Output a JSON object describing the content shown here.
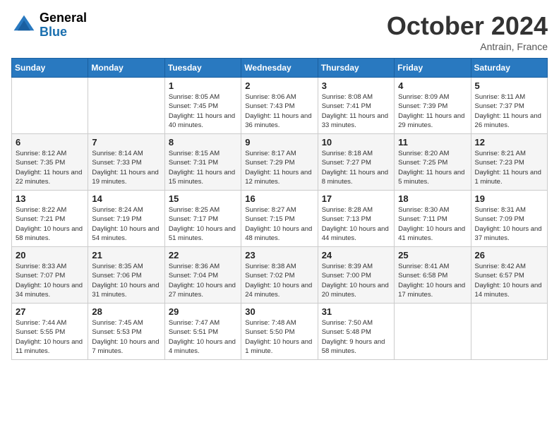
{
  "header": {
    "logo_general": "General",
    "logo_blue": "Blue",
    "month_title": "October 2024",
    "location": "Antrain, France"
  },
  "days_of_week": [
    "Sunday",
    "Monday",
    "Tuesday",
    "Wednesday",
    "Thursday",
    "Friday",
    "Saturday"
  ],
  "weeks": [
    [
      {
        "day": "",
        "info": ""
      },
      {
        "day": "",
        "info": ""
      },
      {
        "day": "1",
        "info": "Sunrise: 8:05 AM\nSunset: 7:45 PM\nDaylight: 11 hours and 40 minutes."
      },
      {
        "day": "2",
        "info": "Sunrise: 8:06 AM\nSunset: 7:43 PM\nDaylight: 11 hours and 36 minutes."
      },
      {
        "day": "3",
        "info": "Sunrise: 8:08 AM\nSunset: 7:41 PM\nDaylight: 11 hours and 33 minutes."
      },
      {
        "day": "4",
        "info": "Sunrise: 8:09 AM\nSunset: 7:39 PM\nDaylight: 11 hours and 29 minutes."
      },
      {
        "day": "5",
        "info": "Sunrise: 8:11 AM\nSunset: 7:37 PM\nDaylight: 11 hours and 26 minutes."
      }
    ],
    [
      {
        "day": "6",
        "info": "Sunrise: 8:12 AM\nSunset: 7:35 PM\nDaylight: 11 hours and 22 minutes."
      },
      {
        "day": "7",
        "info": "Sunrise: 8:14 AM\nSunset: 7:33 PM\nDaylight: 11 hours and 19 minutes."
      },
      {
        "day": "8",
        "info": "Sunrise: 8:15 AM\nSunset: 7:31 PM\nDaylight: 11 hours and 15 minutes."
      },
      {
        "day": "9",
        "info": "Sunrise: 8:17 AM\nSunset: 7:29 PM\nDaylight: 11 hours and 12 minutes."
      },
      {
        "day": "10",
        "info": "Sunrise: 8:18 AM\nSunset: 7:27 PM\nDaylight: 11 hours and 8 minutes."
      },
      {
        "day": "11",
        "info": "Sunrise: 8:20 AM\nSunset: 7:25 PM\nDaylight: 11 hours and 5 minutes."
      },
      {
        "day": "12",
        "info": "Sunrise: 8:21 AM\nSunset: 7:23 PM\nDaylight: 11 hours and 1 minute."
      }
    ],
    [
      {
        "day": "13",
        "info": "Sunrise: 8:22 AM\nSunset: 7:21 PM\nDaylight: 10 hours and 58 minutes."
      },
      {
        "day": "14",
        "info": "Sunrise: 8:24 AM\nSunset: 7:19 PM\nDaylight: 10 hours and 54 minutes."
      },
      {
        "day": "15",
        "info": "Sunrise: 8:25 AM\nSunset: 7:17 PM\nDaylight: 10 hours and 51 minutes."
      },
      {
        "day": "16",
        "info": "Sunrise: 8:27 AM\nSunset: 7:15 PM\nDaylight: 10 hours and 48 minutes."
      },
      {
        "day": "17",
        "info": "Sunrise: 8:28 AM\nSunset: 7:13 PM\nDaylight: 10 hours and 44 minutes."
      },
      {
        "day": "18",
        "info": "Sunrise: 8:30 AM\nSunset: 7:11 PM\nDaylight: 10 hours and 41 minutes."
      },
      {
        "day": "19",
        "info": "Sunrise: 8:31 AM\nSunset: 7:09 PM\nDaylight: 10 hours and 37 minutes."
      }
    ],
    [
      {
        "day": "20",
        "info": "Sunrise: 8:33 AM\nSunset: 7:07 PM\nDaylight: 10 hours and 34 minutes."
      },
      {
        "day": "21",
        "info": "Sunrise: 8:35 AM\nSunset: 7:06 PM\nDaylight: 10 hours and 31 minutes."
      },
      {
        "day": "22",
        "info": "Sunrise: 8:36 AM\nSunset: 7:04 PM\nDaylight: 10 hours and 27 minutes."
      },
      {
        "day": "23",
        "info": "Sunrise: 8:38 AM\nSunset: 7:02 PM\nDaylight: 10 hours and 24 minutes."
      },
      {
        "day": "24",
        "info": "Sunrise: 8:39 AM\nSunset: 7:00 PM\nDaylight: 10 hours and 20 minutes."
      },
      {
        "day": "25",
        "info": "Sunrise: 8:41 AM\nSunset: 6:58 PM\nDaylight: 10 hours and 17 minutes."
      },
      {
        "day": "26",
        "info": "Sunrise: 8:42 AM\nSunset: 6:57 PM\nDaylight: 10 hours and 14 minutes."
      }
    ],
    [
      {
        "day": "27",
        "info": "Sunrise: 7:44 AM\nSunset: 5:55 PM\nDaylight: 10 hours and 11 minutes."
      },
      {
        "day": "28",
        "info": "Sunrise: 7:45 AM\nSunset: 5:53 PM\nDaylight: 10 hours and 7 minutes."
      },
      {
        "day": "29",
        "info": "Sunrise: 7:47 AM\nSunset: 5:51 PM\nDaylight: 10 hours and 4 minutes."
      },
      {
        "day": "30",
        "info": "Sunrise: 7:48 AM\nSunset: 5:50 PM\nDaylight: 10 hours and 1 minute."
      },
      {
        "day": "31",
        "info": "Sunrise: 7:50 AM\nSunset: 5:48 PM\nDaylight: 9 hours and 58 minutes."
      },
      {
        "day": "",
        "info": ""
      },
      {
        "day": "",
        "info": ""
      }
    ]
  ]
}
